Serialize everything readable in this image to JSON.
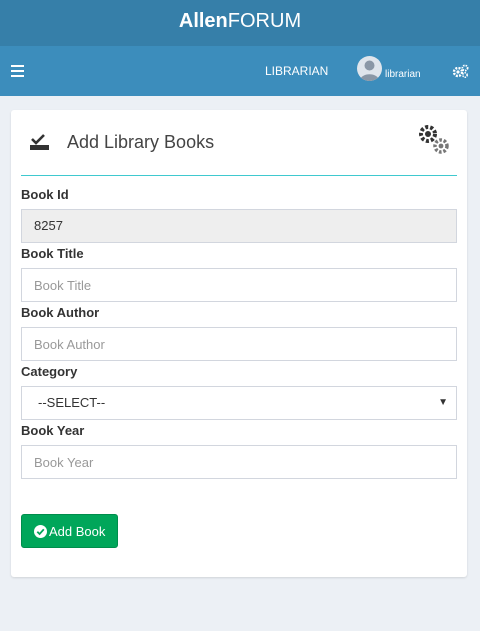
{
  "brand": {
    "bold": "Allen",
    "light": "FORUM"
  },
  "navbar": {
    "menu_icon": "hamburger-icon",
    "role": "LIBRARIAN",
    "username": "librarian",
    "settings_icon": "gears-icon"
  },
  "form": {
    "title": "Add Library Books",
    "fields": {
      "book_id": {
        "label": "Book Id",
        "value": "8257"
      },
      "book_title": {
        "label": "Book Title",
        "placeholder": "Book Title"
      },
      "book_author": {
        "label": "Book Author",
        "placeholder": "Book Author"
      },
      "category": {
        "label": "Category",
        "selected": "--SELECT--"
      },
      "book_year": {
        "label": "Book Year",
        "placeholder": "Book Year"
      }
    },
    "submit_label": "Add Book"
  },
  "colors": {
    "logo_bar": "#367fa9",
    "navbar": "#3c8dbc",
    "accent_line": "#3fc9cf",
    "button": "#00a65a"
  }
}
